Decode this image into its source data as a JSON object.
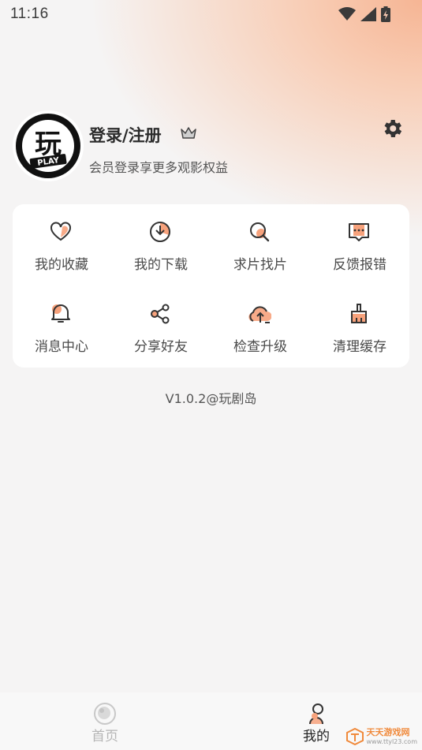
{
  "status_bar": {
    "time": "11:16"
  },
  "profile": {
    "title": "登录/注册",
    "subtitle": "会员登录享更多观影权益",
    "avatar_text": "玩",
    "avatar_sub": "PLAY"
  },
  "menu": {
    "items": [
      {
        "label": "我的收藏",
        "icon": "heart-icon"
      },
      {
        "label": "我的下载",
        "icon": "download-icon"
      },
      {
        "label": "求片找片",
        "icon": "search-icon"
      },
      {
        "label": "反馈报错",
        "icon": "feedback-icon"
      },
      {
        "label": "消息中心",
        "icon": "bell-icon"
      },
      {
        "label": "分享好友",
        "icon": "share-icon"
      },
      {
        "label": "检查升级",
        "icon": "upgrade-icon"
      },
      {
        "label": "清理缓存",
        "icon": "broom-icon"
      }
    ]
  },
  "version": "V1.0.2@玩剧岛",
  "tab_bar": {
    "home": "首页",
    "mine": "我的"
  },
  "watermark": {
    "text": "天天游戏网",
    "url": "www.ttyl23.com"
  },
  "colors": {
    "accent": "#f7a27c",
    "dark": "#333333"
  }
}
